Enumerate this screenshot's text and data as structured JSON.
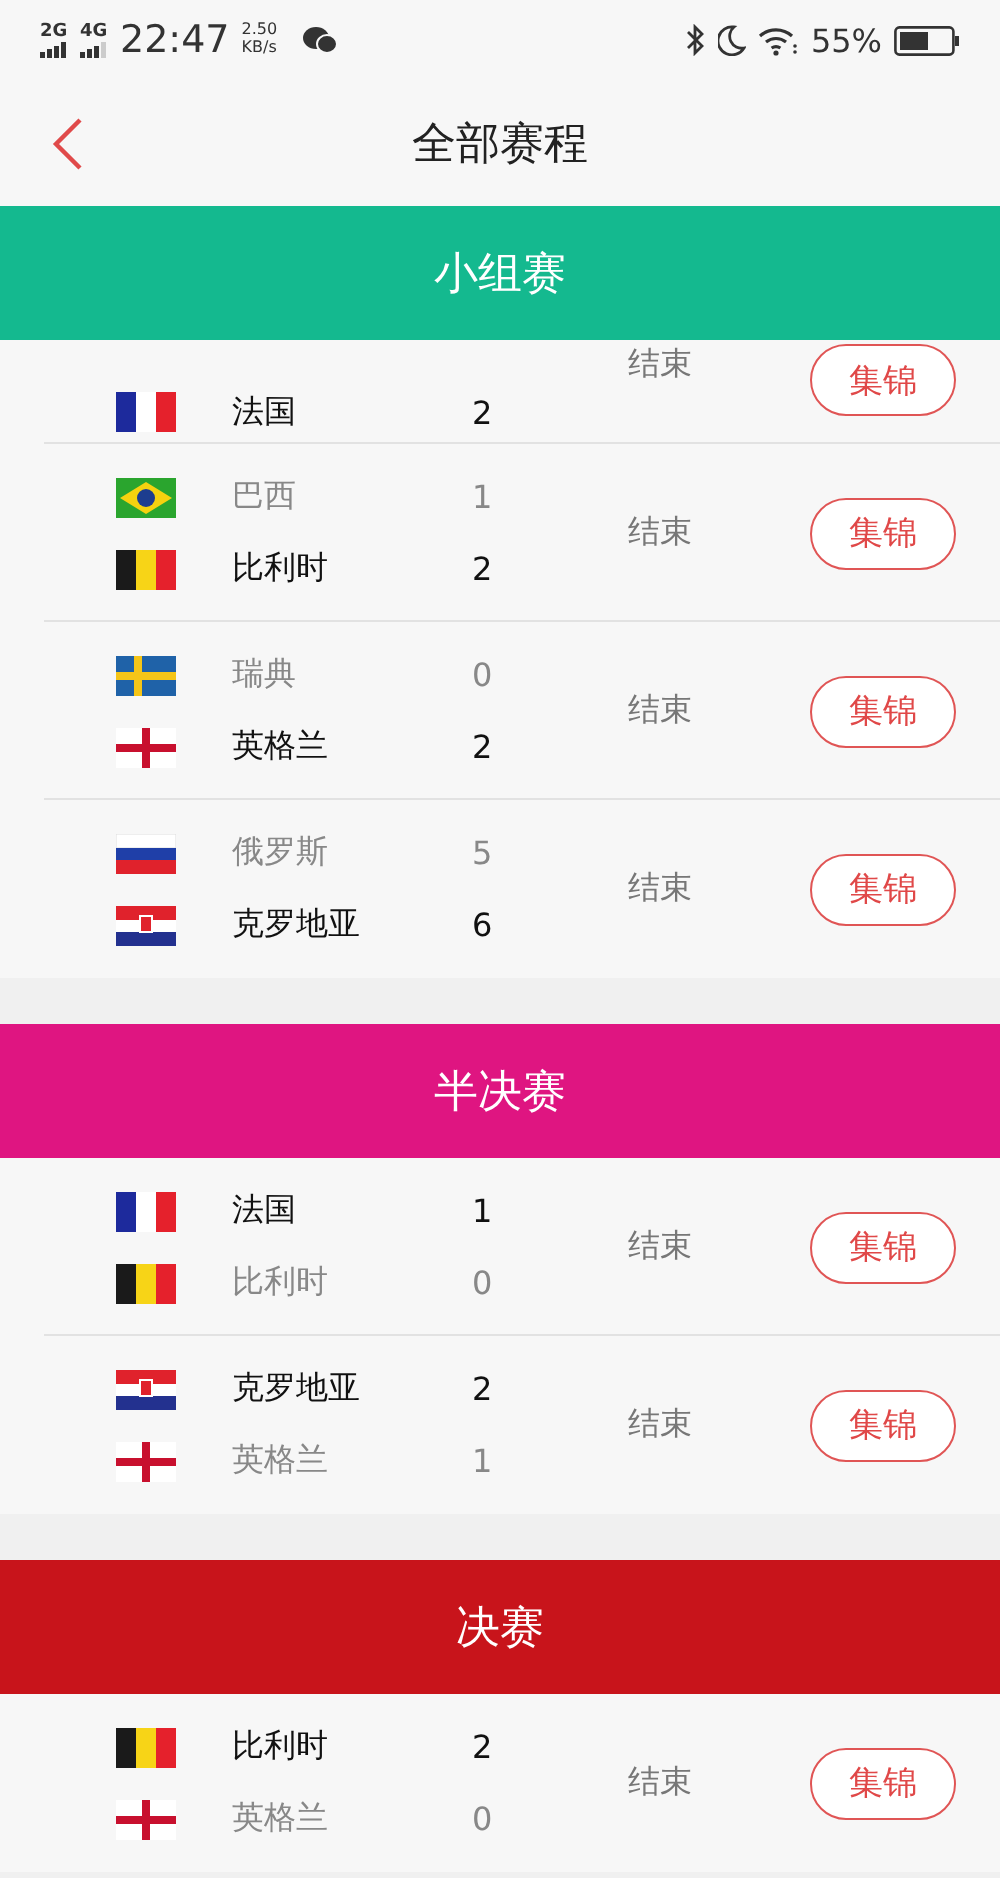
{
  "status_bar": {
    "sim_1": "2G",
    "sim_2": "4G",
    "time": "22:47",
    "speed": "2.50",
    "speed_unit": "KB/s",
    "battery": "55%"
  },
  "nav": {
    "title": "全部赛程"
  },
  "sections": [
    {
      "title": "小组赛",
      "color": "#14b98f",
      "matches": [
        {
          "partial": true,
          "teams": [
            {
              "kind": "france",
              "name": "法国",
              "score": "2",
              "winner": true
            }
          ],
          "status": "结束",
          "button": "集锦"
        },
        {
          "partial": false,
          "teams": [
            {
              "kind": "brazil",
              "name": "巴西",
              "score": "1",
              "winner": false
            },
            {
              "kind": "belgium",
              "name": "比利时",
              "score": "2",
              "winner": true
            }
          ],
          "status": "结束",
          "button": "集锦"
        },
        {
          "partial": false,
          "teams": [
            {
              "kind": "sweden",
              "name": "瑞典",
              "score": "0",
              "winner": false
            },
            {
              "kind": "england",
              "name": "英格兰",
              "score": "2",
              "winner": true
            }
          ],
          "status": "结束",
          "button": "集锦"
        },
        {
          "partial": false,
          "teams": [
            {
              "kind": "russia",
              "name": "俄罗斯",
              "score": "5",
              "winner": false
            },
            {
              "kind": "croatia",
              "name": "克罗地亚",
              "score": "6",
              "winner": true
            }
          ],
          "status": "结束",
          "button": "集锦"
        }
      ]
    },
    {
      "title": "半决赛",
      "color": "#df1581",
      "matches": [
        {
          "partial": false,
          "teams": [
            {
              "kind": "france",
              "name": "法国",
              "score": "1",
              "winner": true
            },
            {
              "kind": "belgium",
              "name": "比利时",
              "score": "0",
              "winner": false
            }
          ],
          "status": "结束",
          "button": "集锦"
        },
        {
          "partial": false,
          "teams": [
            {
              "kind": "croatia",
              "name": "克罗地亚",
              "score": "2",
              "winner": true
            },
            {
              "kind": "england",
              "name": "英格兰",
              "score": "1",
              "winner": false
            }
          ],
          "status": "结束",
          "button": "集锦"
        }
      ]
    },
    {
      "title": "决赛",
      "color": "#c8141b",
      "matches": [
        {
          "partial": false,
          "teams": [
            {
              "kind": "belgium",
              "name": "比利时",
              "score": "2",
              "winner": true
            },
            {
              "kind": "england",
              "name": "英格兰",
              "score": "0",
              "winner": false
            }
          ],
          "status": "结束",
          "button": "集锦"
        }
      ]
    }
  ]
}
